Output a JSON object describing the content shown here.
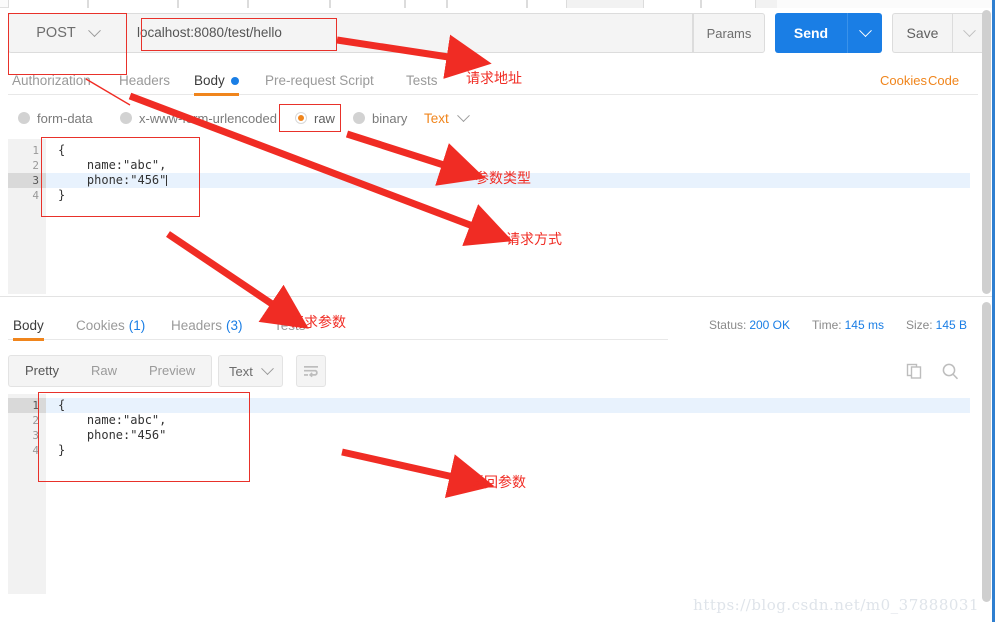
{
  "request": {
    "method": "POST",
    "url": "localhost:8080/test/hello",
    "params_label": "Params",
    "send_label": "Send",
    "save_label": "Save",
    "tabs": [
      {
        "label": "Authorization",
        "active": false
      },
      {
        "label": "Headers",
        "active": false
      },
      {
        "label": "Body",
        "active": true,
        "dot": true
      },
      {
        "label": "Pre-request Script",
        "active": false
      },
      {
        "label": "Tests",
        "active": false
      }
    ],
    "cookies_link": "Cookies",
    "code_link": "Code",
    "body_types": [
      {
        "label": "form-data",
        "selected": false
      },
      {
        "label": "x-www-form-urlencoded",
        "selected": false
      },
      {
        "label": "raw",
        "selected": true
      },
      {
        "label": "binary",
        "selected": false
      }
    ],
    "raw_format": "Text",
    "body_lines": [
      "{",
      "    name:\"abc\",",
      "    phone:\"456\"",
      "}"
    ],
    "body_line_numbers": [
      "1",
      "2",
      "3",
      "4"
    ],
    "body_active_line": 3
  },
  "response": {
    "tabs": [
      {
        "label": "Body",
        "count": "",
        "active": true
      },
      {
        "label": "Cookies",
        "count": "(1)",
        "active": false
      },
      {
        "label": "Headers",
        "count": "(3)",
        "active": false
      },
      {
        "label": "Tests",
        "count": "",
        "active": false
      }
    ],
    "status_label": "Status:",
    "status_value": "200 OK",
    "time_label": "Time:",
    "time_value": "145 ms",
    "size_label": "Size:",
    "size_value": "145 B",
    "view_modes": [
      {
        "label": "Pretty",
        "active": true
      },
      {
        "label": "Raw",
        "active": false
      },
      {
        "label": "Preview",
        "active": false
      }
    ],
    "format": "Text",
    "body_lines": [
      "{",
      "    name:\"abc\",",
      "    phone:\"456\"",
      "}"
    ],
    "body_line_numbers": [
      "1",
      "2",
      "3",
      "4"
    ],
    "body_active_line": 1
  },
  "annotations": [
    {
      "id": "a1",
      "text": "请求地址"
    },
    {
      "id": "a2",
      "text": "参数类型"
    },
    {
      "id": "a3",
      "text": "请求方式"
    },
    {
      "id": "a4",
      "text": "请求参数"
    },
    {
      "id": "a5",
      "text": "返回参数"
    }
  ],
  "watermark": "https://blog.csdn.net/m0_37888031",
  "colors": {
    "send_blue": "#1a7ee5",
    "accent_orange": "#f0851c",
    "annotation_red": "#f02c24",
    "link_blue": "#1a7ee5"
  }
}
